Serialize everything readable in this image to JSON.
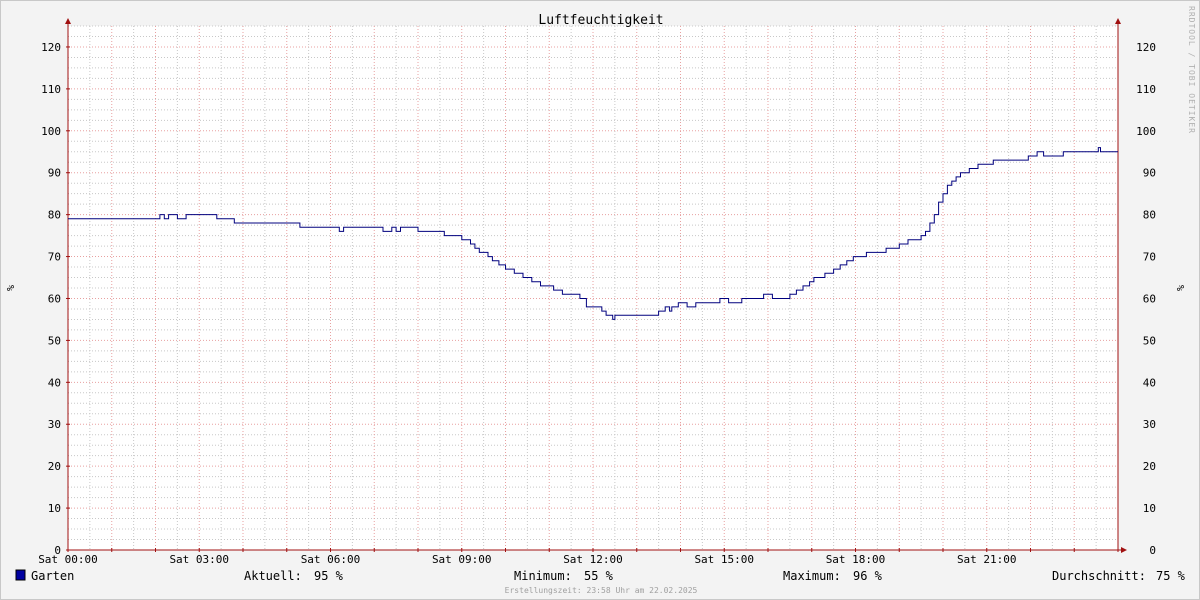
{
  "chart_data": {
    "type": "line",
    "title": "Luftfeuchtigkeit",
    "ylabel": "%",
    "ylim": [
      0,
      125
    ],
    "yticks": [
      0,
      10,
      20,
      30,
      40,
      50,
      60,
      70,
      80,
      90,
      100,
      110,
      120
    ],
    "xlim_hours": [
      0,
      24
    ],
    "xtick_hours": [
      0,
      3,
      6,
      9,
      12,
      15,
      18,
      21
    ],
    "xtick_labels": [
      "Sat 00:00",
      "Sat 03:00",
      "Sat 06:00",
      "Sat 09:00",
      "Sat 12:00",
      "Sat 15:00",
      "Sat 18:00",
      "Sat 21:00"
    ],
    "grid": true,
    "legend_position": "bottom-left",
    "colors": {
      "series": "#00007f",
      "minor_grid": "#c8c8c8",
      "major_grid": "#e8a0a0",
      "axis": "#a01010",
      "plot_bg": "#ffffff",
      "page_bg": "#f3f3f3",
      "legend_swatch": "#0000a0"
    },
    "series": [
      {
        "name": "Garten",
        "points": [
          [
            0,
            79
          ],
          [
            2.05,
            79
          ],
          [
            2.1,
            80
          ],
          [
            2.2,
            79
          ],
          [
            2.3,
            80
          ],
          [
            2.5,
            79
          ],
          [
            2.7,
            80
          ],
          [
            3.3,
            80
          ],
          [
            3.4,
            79
          ],
          [
            3.75,
            79
          ],
          [
            3.8,
            78
          ],
          [
            5.2,
            78
          ],
          [
            5.3,
            77
          ],
          [
            6.15,
            77
          ],
          [
            6.2,
            76
          ],
          [
            6.3,
            77
          ],
          [
            7.1,
            77
          ],
          [
            7.2,
            76
          ],
          [
            7.4,
            77
          ],
          [
            7.5,
            76
          ],
          [
            7.6,
            77
          ],
          [
            7.9,
            77
          ],
          [
            8.0,
            76
          ],
          [
            8.5,
            76
          ],
          [
            8.6,
            75
          ],
          [
            8.9,
            75
          ],
          [
            9.0,
            74
          ],
          [
            9.2,
            73
          ],
          [
            9.3,
            72
          ],
          [
            9.4,
            71
          ],
          [
            9.6,
            70
          ],
          [
            9.7,
            69
          ],
          [
            9.85,
            68
          ],
          [
            10.0,
            67
          ],
          [
            10.2,
            66
          ],
          [
            10.4,
            65
          ],
          [
            10.6,
            64
          ],
          [
            10.8,
            63
          ],
          [
            11.1,
            62
          ],
          [
            11.3,
            61
          ],
          [
            11.7,
            60
          ],
          [
            11.85,
            58
          ],
          [
            12.2,
            57
          ],
          [
            12.3,
            56
          ],
          [
            12.45,
            55
          ],
          [
            12.5,
            56
          ],
          [
            13.4,
            56
          ],
          [
            13.5,
            57
          ],
          [
            13.65,
            58
          ],
          [
            13.75,
            57
          ],
          [
            13.8,
            58
          ],
          [
            13.95,
            59
          ],
          [
            14.15,
            58
          ],
          [
            14.35,
            59
          ],
          [
            14.8,
            59
          ],
          [
            14.9,
            60
          ],
          [
            15.1,
            59
          ],
          [
            15.4,
            60
          ],
          [
            15.9,
            61
          ],
          [
            16.1,
            60
          ],
          [
            16.4,
            60
          ],
          [
            16.5,
            61
          ],
          [
            16.65,
            62
          ],
          [
            16.8,
            63
          ],
          [
            16.95,
            64
          ],
          [
            17.05,
            65
          ],
          [
            17.3,
            66
          ],
          [
            17.5,
            67
          ],
          [
            17.65,
            68
          ],
          [
            17.8,
            69
          ],
          [
            17.95,
            70
          ],
          [
            18.25,
            71
          ],
          [
            18.7,
            72
          ],
          [
            19.0,
            73
          ],
          [
            19.2,
            74
          ],
          [
            19.5,
            75
          ],
          [
            19.6,
            76
          ],
          [
            19.7,
            78
          ],
          [
            19.8,
            80
          ],
          [
            19.9,
            83
          ],
          [
            20.0,
            85
          ],
          [
            20.1,
            87
          ],
          [
            20.2,
            88
          ],
          [
            20.3,
            89
          ],
          [
            20.4,
            90
          ],
          [
            20.6,
            91
          ],
          [
            20.8,
            92
          ],
          [
            21.15,
            93
          ],
          [
            21.95,
            94
          ],
          [
            22.15,
            95
          ],
          [
            22.3,
            94
          ],
          [
            22.75,
            95
          ],
          [
            23.5,
            95
          ],
          [
            23.55,
            96
          ],
          [
            23.6,
            95
          ],
          [
            24.0,
            95
          ]
        ]
      }
    ]
  },
  "legend": {
    "name": "Garten",
    "current_label": "Aktuell:",
    "current_value": "95 %",
    "min_label": "Minimum:",
    "min_value": "55 %",
    "max_label": "Maximum:",
    "max_value": "96 %",
    "avg_label": "Durchschnitt:",
    "avg_value": "75 %"
  },
  "watermark": "RRDTOOL / TOBI OETIKER",
  "credit": "Erstellungszeit: 23:58 Uhr am 22.02.2025"
}
